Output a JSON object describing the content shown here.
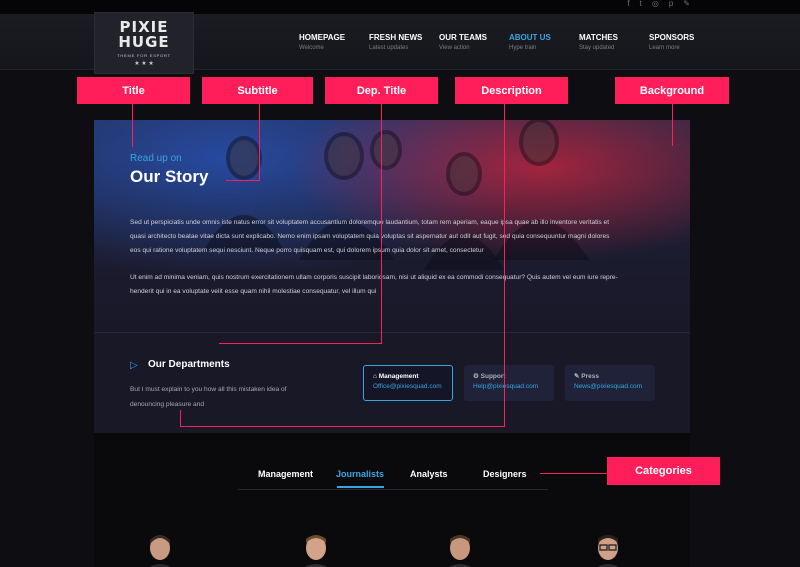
{
  "social": {
    "icons": [
      "facebook-icon",
      "twitter-icon",
      "instagram-icon",
      "pinterest-icon",
      "discord-icon"
    ],
    "glyphs": [
      "f",
      "t",
      "◎",
      "p",
      "✎"
    ]
  },
  "logo": {
    "line1": "PIXIE",
    "line2": "HUGE",
    "tagline": "THEME FOR ESPORT",
    "stars": "★ ★ ★"
  },
  "nav": {
    "items": [
      {
        "label": "HOMEPAGE",
        "sub": "Welcome"
      },
      {
        "label": "FRESH NEWS",
        "sub": "Latest updates"
      },
      {
        "label": "OUR TEAMS",
        "sub": "View action"
      },
      {
        "label": "ABOUT US",
        "sub": "Hype train"
      },
      {
        "label": "MATCHES",
        "sub": "Stay updated"
      },
      {
        "label": "SPONSORS",
        "sub": "Learn more"
      }
    ],
    "active_index": 3
  },
  "callouts": {
    "title": "Title",
    "subtitle": "Subtitle",
    "dep_title": "Dep. Title",
    "description": "Description",
    "background": "Background",
    "categories": "Categories"
  },
  "story": {
    "kicker": "Read up on",
    "title": "Our Story",
    "p1_l1": "Sed ut perspiciatis unde omnis iste natus error sit voluptatem accusantium doloremque laudantium, totam rem aperiam, eaque ipsa quae ab illo inventore veritatis et",
    "p1_l2": "quasi architecto beatae vitae dicta sunt explicabo. Nemo enim ipsam voluptatem quia voluptas sit aspernatur aut odit aut fugit, sed quia consequuntur magni dolores",
    "p1_l3": "eos qui ratione voluptatem sequi nesciunt. Neque porro quisquam est, qui dolorem ipsum quia dolor sit amet, consectetur",
    "p2_l1": "Ut enim ad minima veniam, quis nostrum exercitationem ullam corporis suscipit laboriosam, nisi ut aliquid ex ea commodi consequatur? Quis autem vel eum iure repre-",
    "p2_l2": "henderit qui in ea voluptate velit esse quam nihil molestiae consequatur, vel illum qui"
  },
  "departments": {
    "title": "Our Departments",
    "desc_l1": "But I must explain to you how all this mistaken idea of",
    "desc_l2": "denouncing pleasure and",
    "cards": [
      {
        "name": "Management",
        "email": "Office@pixiesquad.com",
        "icon": "home-icon",
        "glyph": "⌂"
      },
      {
        "name": "Support",
        "email": "Help@pixiesquad.com",
        "icon": "gear-icon",
        "glyph": "⚙"
      },
      {
        "name": "Press",
        "email": "News@pixiesquad.com",
        "icon": "pen-icon",
        "glyph": "✎"
      }
    ],
    "active_index": 0
  },
  "tabs": {
    "items": [
      "Management",
      "Journalists",
      "Analysts",
      "Designers"
    ],
    "active_index": 1
  },
  "colors": {
    "accent": "#36a6e0",
    "callout": "#ff1e5a",
    "panel": "#181827",
    "page": "#0d0d12"
  }
}
